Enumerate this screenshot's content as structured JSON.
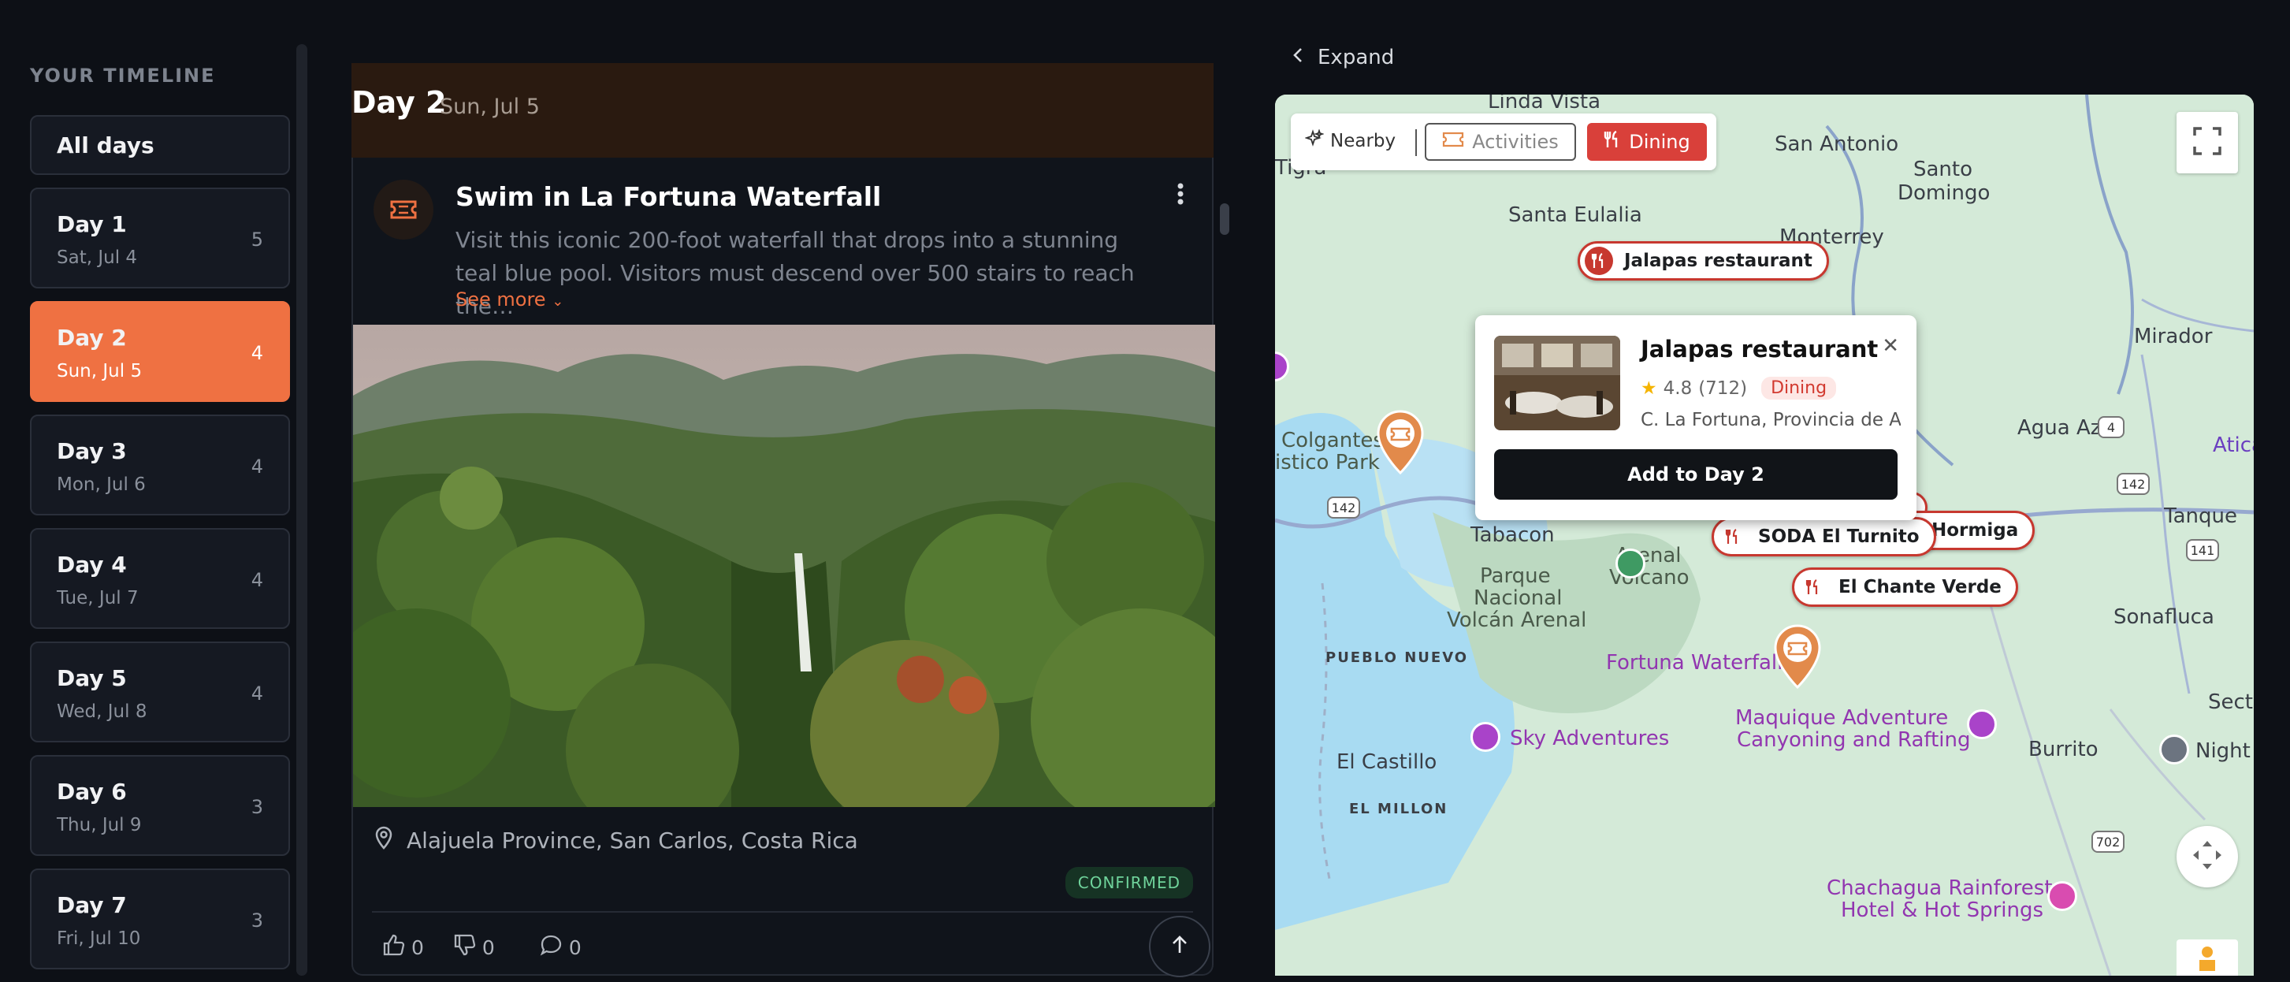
{
  "sidebar": {
    "heading": "YOUR TIMELINE",
    "all_days": "All days",
    "days": [
      {
        "title": "Day 1",
        "date": "Sat, Jul 4",
        "count": "5"
      },
      {
        "title": "Day 2",
        "date": "Sun, Jul 5",
        "count": "4"
      },
      {
        "title": "Day 3",
        "date": "Mon, Jul 6",
        "count": "4"
      },
      {
        "title": "Day 4",
        "date": "Tue, Jul 7",
        "count": "4"
      },
      {
        "title": "Day 5",
        "date": "Wed, Jul 8",
        "count": "4"
      },
      {
        "title": "Day 6",
        "date": "Thu, Jul 9",
        "count": "3"
      },
      {
        "title": "Day 7",
        "date": "Fri, Jul 10",
        "count": "3"
      }
    ],
    "active_day": "Day 2"
  },
  "day_header": {
    "title": "Day 2",
    "date": "Sun, Jul 5"
  },
  "activity": {
    "title": "Swim in La Fortuna Waterfall",
    "description": "Visit this iconic 200-foot waterfall that drops into a stunning teal blue pool. Visitors must descend over 500 stairs to reach the…",
    "see_more": "See more",
    "location": "Alajuela Province, San Carlos, Costa Rica",
    "status": "CONFIRMED",
    "likes": "0",
    "dislikes": "0",
    "comments": "0"
  },
  "map": {
    "expand_label": "Expand",
    "filters": {
      "nearby": "Nearby",
      "activities": "Activities",
      "dining": "Dining"
    },
    "places": {
      "linda_vista": "Linda Vista",
      "tigra": "Tigra",
      "san_antonio": "San Antonio",
      "santo_domingo_1": "Santo",
      "santo_domingo_2": "Domingo",
      "santa_eulalia": "Santa Eulalia",
      "monterrey": "Monterrey",
      "mirador": "Mirador",
      "agua_azul": "Agua Azul",
      "atica": "Atica",
      "tanque": "Tanque",
      "colgantes_1": "Colgantes",
      "colgantes_2": "istico Park",
      "tabacon": "Tabacon",
      "parque_1": "Parque",
      "parque_2": "Nacional",
      "parque_3": "Volcán Arenal",
      "arenal_1": "Arenal",
      "arenal_2": "Volcano",
      "pueblo_nuevo": "PUEBLO NUEVO",
      "fortuna_waterfall": "Fortuna Waterfall",
      "sonafluca": "Sonafluca",
      "sector": "Sector",
      "maquique_1": "Maquique Adventure",
      "maquique_2": "Canyoning and Rafting",
      "sky_adventures": "Sky Adventures",
      "el_castillo": "El Castillo",
      "el_millon": "EL MILLON",
      "burrito": "Burrito",
      "night_t": "Night T",
      "chachagua_1": "Chachagua Rainforest",
      "chachagua_2": "Hotel & Hot Springs"
    },
    "roads": [
      "142",
      "4",
      "142",
      "141",
      "702"
    ],
    "pins": {
      "jalapas": "Jalapas restaurant",
      "soda": "SODA El Turnito",
      "hormiga": "Hormiga",
      "chante": "El Chante Verde"
    },
    "popup": {
      "title": "Jalapas restaurant",
      "rating": "4.8",
      "reviews": "(712)",
      "category": "Dining",
      "address": "C. La Fortuna, Provincia de Alajuela",
      "button": "Add to Day 2"
    }
  }
}
